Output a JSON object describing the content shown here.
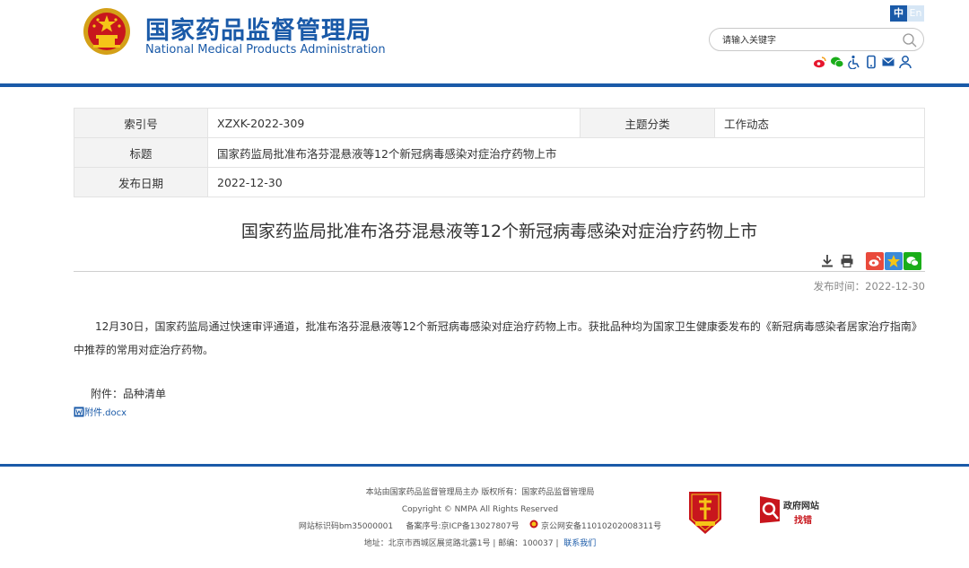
{
  "header": {
    "site_name_cn": "国家药品监督管理局",
    "site_name_en": "National Medical Products Administration",
    "lang_zh": "中",
    "lang_en": "En",
    "search_placeholder": "请输入关键字"
  },
  "social_icons": [
    "weibo-icon",
    "wechat-icon",
    "accessibility-icon",
    "mobile-icon",
    "mail-icon",
    "user-icon"
  ],
  "meta": {
    "index_label": "索引号",
    "index_value": "XZXK-2022-309",
    "topic_label": "主题分类",
    "topic_value": "工作动态",
    "title_label": "标题",
    "title_value": "国家药监局批准布洛芬混悬液等12个新冠病毒感染对症治疗药物上市",
    "date_label": "发布日期",
    "date_value": "2022-12-30"
  },
  "article": {
    "title": "国家药监局批准布洛芬混悬液等12个新冠病毒感染对症治疗药物上市",
    "publish_time": "发布时间：2022-12-30",
    "body": "12月30日，国家药监局通过快速审评通道，批准布洛芬混悬液等12个新冠病毒感染对症治疗药物上市。获批品种均为国家卫生健康委发布的《新冠病毒感染者居家治疗指南》中推荐的常用对症治疗药物。",
    "attachment_label": "附件：品种清单",
    "attachment_file": "附件.docx"
  },
  "footer": {
    "line1": "本站由国家药品监督管理局主办 版权所有：国家药品监督管理局",
    "line2": "Copyright © NMPA All Rights Reserved",
    "line3_site_id": "网站标识码bm35000001",
    "line3_icp": "备案序号:京ICP备13027807号",
    "line3_police": "京公网安备11010202008311号",
    "line4_address": "地址：北京市西城区展览路北露1号 | 邮编：100037 |",
    "contact_link": "联系我们",
    "gov_badge_title": "政府网站",
    "gov_badge_sub": "找错"
  },
  "colors": {
    "brand_blue": "#1a5aa8",
    "red": "#c8161d",
    "table_label_bg": "#f3f3f3"
  }
}
